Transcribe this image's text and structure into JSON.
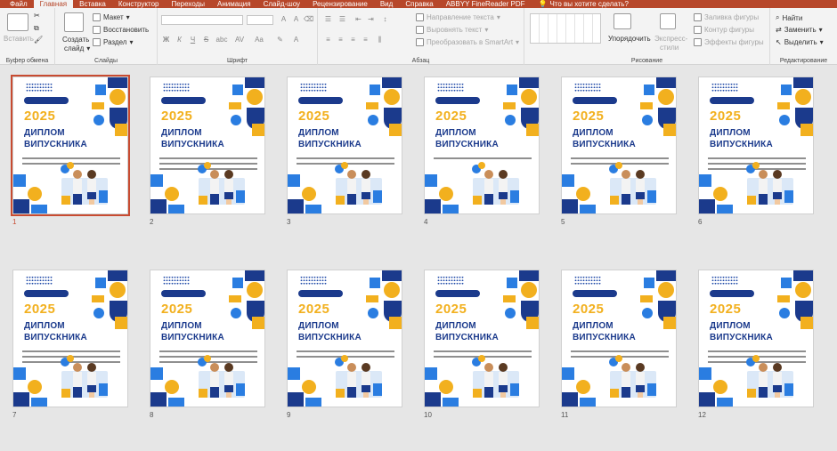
{
  "tabs": [
    "Файл",
    "Главная",
    "Вставка",
    "Конструктор",
    "Переходы",
    "Анимация",
    "Слайд-шоу",
    "Рецензирование",
    "Вид",
    "Справка",
    "ABBYY FineReader PDF"
  ],
  "active_tab": "Главная",
  "tell_me": "Что вы хотите сделать?",
  "ribbon": {
    "clipboard": {
      "paste": "Вставить",
      "label": "Буфер обмена"
    },
    "slides": {
      "new_slide_1": "Создать",
      "new_slide_2": "слайд",
      "layout": "Макет",
      "reset": "Восстановить",
      "section": "Раздел",
      "label": "Слайды"
    },
    "font": {
      "label": "Шрифт",
      "bold": "Ж",
      "italic": "К",
      "underline": "Ч",
      "strike": "S",
      "shadow": "abc",
      "spacing": "AV",
      "case": "Aa"
    },
    "paragraph": {
      "direction": "Направление текста",
      "align": "Выровнять текст",
      "smartart": "Преобразовать в SmartArt",
      "label": "Абзац"
    },
    "drawing": {
      "arrange": "Упорядочить",
      "styles_1": "Экспресс-",
      "styles_2": "стили",
      "fill": "Заливка фигуры",
      "outline": "Контур фигуры",
      "effects": "Эффекты фигуры",
      "label": "Рисование"
    },
    "editing": {
      "find": "Найти",
      "replace": "Заменить",
      "select": "Выделить",
      "label": "Редактирование"
    }
  },
  "slides": [
    {
      "num": "1",
      "year": "2025",
      "title1": "ДИПЛОМ",
      "title2": "ВИПУСКНИКА",
      "lines": 2
    },
    {
      "num": "2",
      "year": "2025",
      "title1": "ДИПЛОМ",
      "title2": "ВИПУСКНИКА",
      "lines": 3
    },
    {
      "num": "3",
      "year": "2025",
      "title1": "ДИПЛОМ",
      "title2": "ВИПУСКНИКА",
      "lines": 2
    },
    {
      "num": "4",
      "year": "2025",
      "title1": "ДИПЛОМ",
      "title2": "ВИПУСКНИКА",
      "lines": 1
    },
    {
      "num": "5",
      "year": "2025",
      "title1": "ДИПЛОМ",
      "title2": "ВИПУСКНИКА",
      "lines": 2
    },
    {
      "num": "6",
      "year": "2025",
      "title1": "ДИПЛОМ",
      "title2": "ВИПУСКНИКА",
      "lines": 3
    },
    {
      "num": "7",
      "year": "2025",
      "title1": "ДИПЛОМ",
      "title2": "ВИПУСКНИКА",
      "lines": 3
    },
    {
      "num": "8",
      "year": "2025",
      "title1": "ДИПЛОМ",
      "title2": "ВИПУСКНИКА",
      "lines": 3
    },
    {
      "num": "9",
      "year": "2025",
      "title1": "ДИПЛОМ",
      "title2": "ВИПУСКНИКА",
      "lines": 2
    },
    {
      "num": "10",
      "year": "2025",
      "title1": "ДИПЛОМ",
      "title2": "ВИПУСКНИКА",
      "lines": 2
    },
    {
      "num": "11",
      "year": "2025",
      "title1": "ДИПЛОМ",
      "title2": "ВИПУСКНИКА",
      "lines": 2
    },
    {
      "num": "12",
      "year": "2025",
      "title1": "ДИПЛОМ",
      "title2": "ВИПУСКНИКА",
      "lines": 3
    }
  ],
  "selected_slide": "1",
  "colors": {
    "accent": "#b7472a",
    "navy": "#1b3a8c",
    "yellow": "#f2b01e",
    "blue": "#2a7de1"
  }
}
